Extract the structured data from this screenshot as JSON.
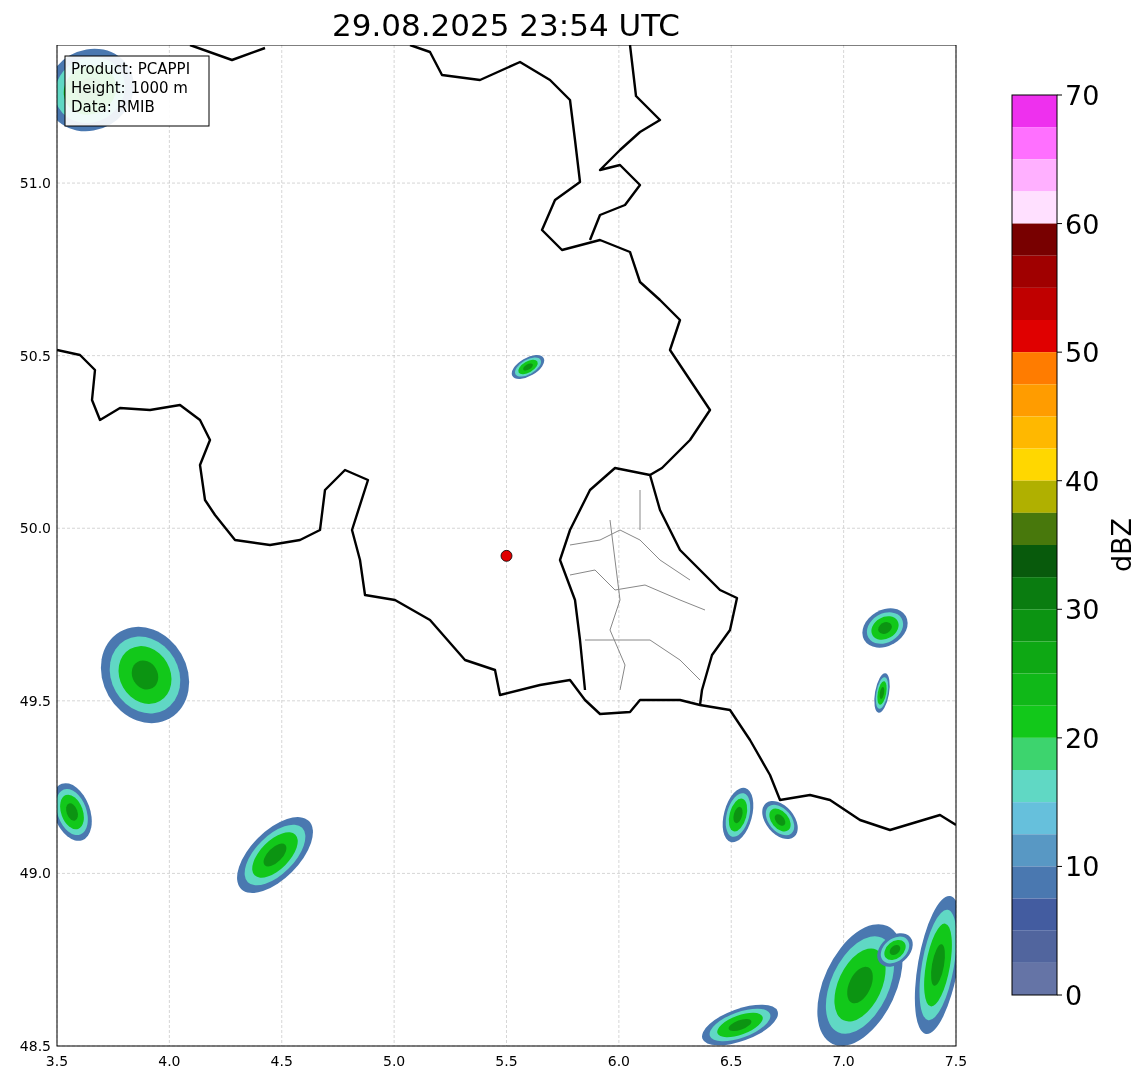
{
  "title": "29.08.2025 23:54 UTC",
  "info_box": [
    "Product: PCAPPI",
    "Height: 1000 m",
    "Data: RMIB"
  ],
  "map": {
    "grid": true,
    "xticks": [
      "3.5",
      "4.0",
      "4.5",
      "5.0",
      "5.5",
      "6.0",
      "6.5",
      "7.0",
      "7.5"
    ],
    "yticks": [
      "51.0",
      "50.5",
      "50.0",
      "49.5",
      "49.0",
      "48.5"
    ]
  },
  "colorbar": {
    "label": "dBZ",
    "ticks": [
      "70",
      "60",
      "50",
      "40",
      "30",
      "20",
      "10",
      "0"
    ],
    "bands": [
      {
        "color": "#ee30ee"
      },
      {
        "color": "#ff70ff"
      },
      {
        "color": "#ffb0ff"
      },
      {
        "color": "#ffe0ff"
      },
      {
        "color": "#780000"
      },
      {
        "color": "#a00000"
      },
      {
        "color": "#c00000"
      },
      {
        "color": "#e00000"
      },
      {
        "color": "#ff7c00"
      },
      {
        "color": "#ff9c00"
      },
      {
        "color": "#ffb800"
      },
      {
        "color": "#ffd700"
      },
      {
        "color": "#b0b000"
      },
      {
        "color": "#48780c"
      },
      {
        "color": "#085a0c"
      },
      {
        "color": "#0a7c10"
      },
      {
        "color": "#0c9412"
      },
      {
        "color": "#0ea814"
      },
      {
        "color": "#10b818"
      },
      {
        "color": "#12c81a"
      },
      {
        "color": "#3dd46e"
      },
      {
        "color": "#60d8c4"
      },
      {
        "color": "#66c0dc"
      },
      {
        "color": "#5898c4"
      },
      {
        "color": "#4a78b0"
      },
      {
        "color": "#435ca0"
      },
      {
        "color": "#51659e"
      },
      {
        "color": "#6574a6"
      }
    ]
  }
}
